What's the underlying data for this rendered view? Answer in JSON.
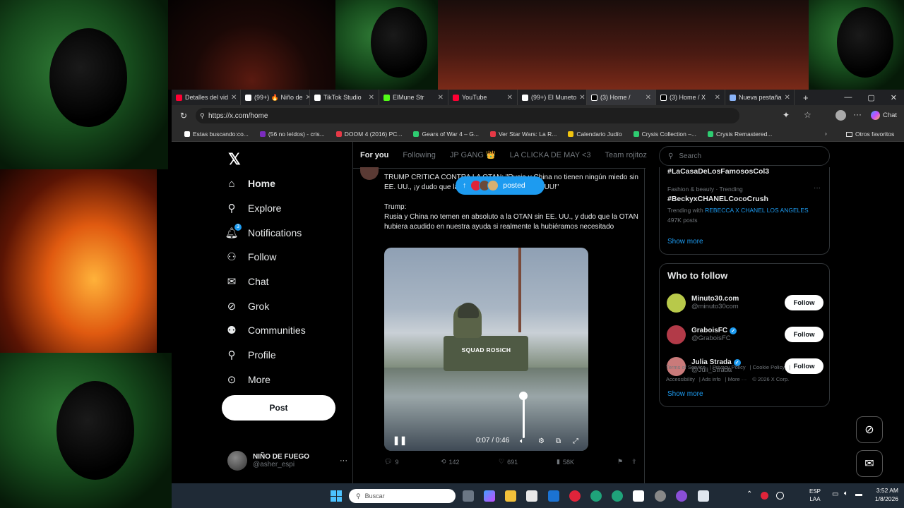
{
  "browser": {
    "tabs": [
      {
        "label": "Detalles del vid",
        "color": "#ff0033"
      },
      {
        "label": "(99+) 🔥 Niño de",
        "color": "#ffffff"
      },
      {
        "label": "TikTok Studio",
        "color": "#ffffff"
      },
      {
        "label": "ElMune Str",
        "color": "#53fc18"
      },
      {
        "label": "YouTube",
        "color": "#ff0033"
      },
      {
        "label": "(99+) El Muneto",
        "color": "#ffffff"
      },
      {
        "label": "(3) Home /",
        "color": "#ffffff"
      },
      {
        "label": "(3) Home / X",
        "color": "#ffffff"
      },
      {
        "label": "Nueva pestaña",
        "color": "#8ab4f8"
      }
    ],
    "url": "https://x.com/home",
    "chat_label": "Chat",
    "bookmarks": [
      {
        "label": "Estas buscando:co...",
        "color": "#ffffff"
      },
      {
        "label": "(56 no leídos) - cris...",
        "color": "#7b2cbf"
      },
      {
        "label": "DOOM 4 (2016) PC...",
        "color": "#e63946"
      },
      {
        "label": "Gears of War 4 – G...",
        "color": "#2ecc71"
      },
      {
        "label": "Ver Star Wars: La R...",
        "color": "#e63946"
      },
      {
        "label": "Calendario Judío",
        "color": "#f1c40f"
      },
      {
        "label": "Crysis Collection –...",
        "color": "#2ecc71"
      },
      {
        "label": "Crysis Remastered...",
        "color": "#2ecc71"
      }
    ],
    "other_bookmarks": "Otros favoritos"
  },
  "nav": {
    "items": [
      {
        "label": "Home",
        "icon": "home-icon"
      },
      {
        "label": "Explore",
        "icon": "search-icon"
      },
      {
        "label": "Notifications",
        "icon": "bell-icon",
        "badge": "3"
      },
      {
        "label": "Follow",
        "icon": "person-add-icon"
      },
      {
        "label": "Chat",
        "icon": "mail-icon"
      },
      {
        "label": "Grok",
        "icon": "grok-icon"
      },
      {
        "label": "Communities",
        "icon": "communities-icon"
      },
      {
        "label": "Profile",
        "icon": "person-icon"
      },
      {
        "label": "More",
        "icon": "more-circle-icon"
      }
    ],
    "post_label": "Post",
    "account": {
      "name": "NIÑO DE FUEGO",
      "handle": "@asher_espi"
    }
  },
  "feed": {
    "tabs": [
      "For you",
      "Following",
      "JP GANG 👑",
      "LA CLICKA DE MAY <3",
      "Team rojitoz"
    ],
    "posted_label": "posted",
    "tweet": {
      "headline": "TRUMP CRITICA CONTRA LA OTAN: \"Rusia y China no tienen ningún miedo sin EE. UU., ¡y dudo que la OTAN estaría ahí para EE.UU!\"",
      "speaker": "Trump:",
      "body": "Rusia y China no temen en absoluto a la OTAN sin EE. UU., y dudo que la OTAN hubiera acudido en nuestra ayuda si realmente la hubiéramos necesitado",
      "video_caption": "SQUAD ROSICH",
      "video_time": "0:07 / 0:46",
      "replies": "9",
      "reposts": "142",
      "likes": "691",
      "views": "58K"
    }
  },
  "sidebar": {
    "search_placeholder": "Search",
    "trend_top": "#LaCasaDeLosFamososCol3",
    "trend": {
      "meta": "Fashion & beauty · Trending",
      "name": "#BeckyxCHANELCocoCrush",
      "with_label": "Trending with",
      "with_value": "REBECCA X CHANEL LOS ANGELES",
      "posts": "497K posts"
    },
    "show_more": "Show more",
    "who_to_follow": {
      "title": "Who to follow",
      "follow_label": "Follow",
      "accounts": [
        {
          "name": "Minuto30.com",
          "handle": "@minuto30com",
          "verified": false,
          "color": "#b8c94a"
        },
        {
          "name": "GraboisFC",
          "handle": "@GraboisFC",
          "verified": true,
          "color": "#b23a48"
        },
        {
          "name": "Julia Strada",
          "handle": "@Juli_Strada",
          "verified": true,
          "color": "#c97a7a"
        }
      ]
    },
    "footer": [
      "Terms of Service",
      "Privacy Policy",
      "Cookie Policy",
      "Accessibility",
      "Ads info",
      "More ···",
      "© 2026 X Corp."
    ]
  },
  "taskbar": {
    "search_placeholder": "Buscar",
    "lang_top": "ESP",
    "lang_bottom": "LAA",
    "time": "3:52 AM",
    "date": "1/8/2026"
  }
}
